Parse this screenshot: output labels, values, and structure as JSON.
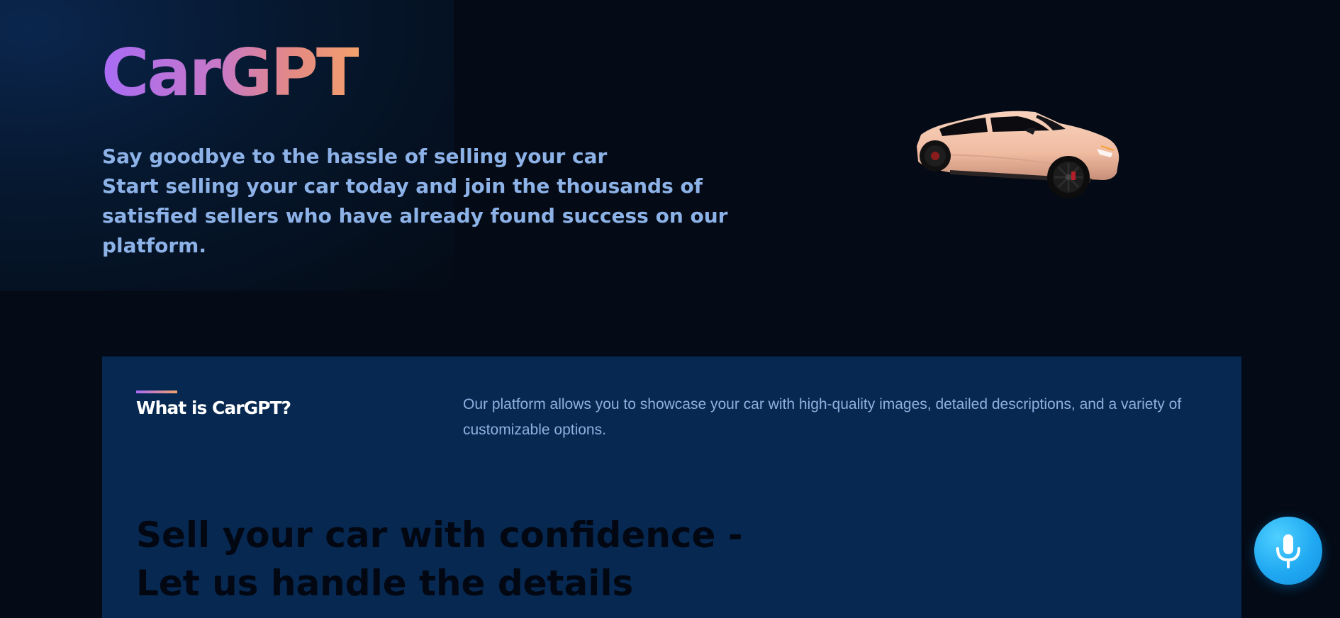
{
  "hero": {
    "title": "CarGPT",
    "lines": [
      "Say goodbye to the hassle of selling your car",
      "Start selling your car today and join the thousands of satisfied sellers who have already found success on our platform."
    ]
  },
  "about": {
    "title": "What is CarGPT?",
    "description": "Our platform allows you to showcase your car with high-quality images, detailed descriptions, and a variety of customizable options.",
    "headline": [
      "Sell your car with confidence -",
      "Let us handle the details"
    ]
  },
  "mic": {
    "icon": "microphone-icon"
  },
  "colors": {
    "background": "#040b16",
    "section": "#062851",
    "accent_start": "#a86cf5",
    "accent_end": "#f3a06d",
    "hero_text": "#8db2e8",
    "mic": "#20a9f2"
  }
}
